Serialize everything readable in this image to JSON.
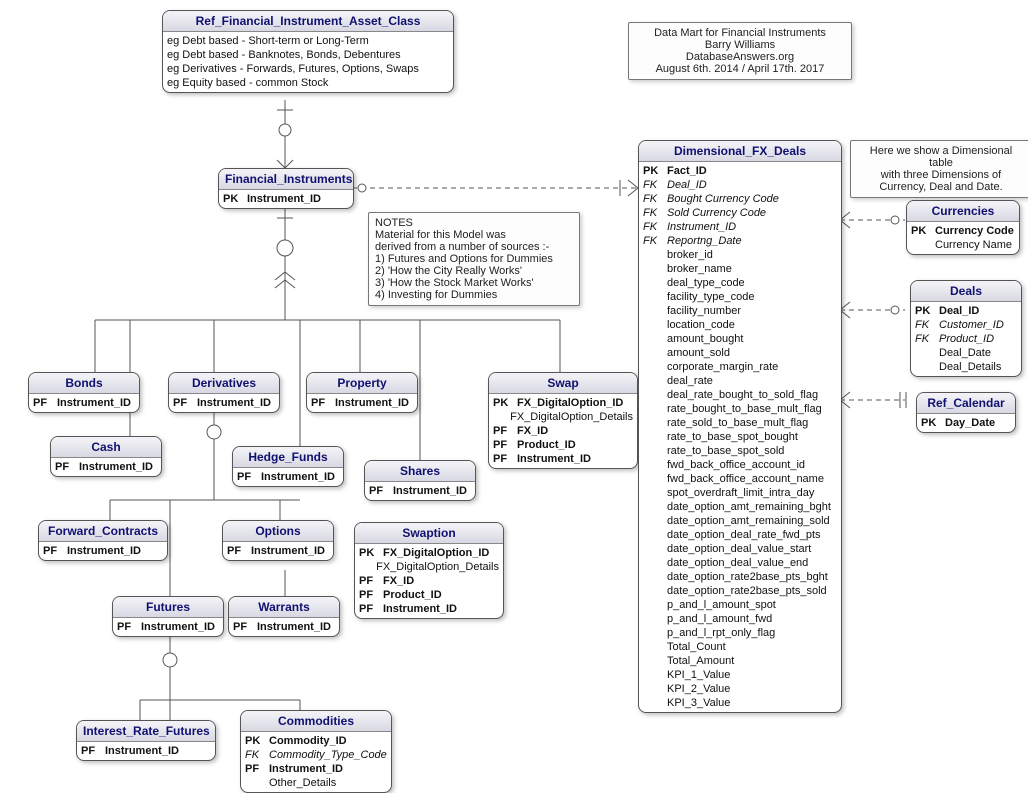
{
  "header_note": {
    "line1": "Data Mart for Financial Instruments",
    "line2": "Barry Williams",
    "line3": "DatabaseAnswers.org",
    "line4": "August 6th. 2014 / April 17th. 2017"
  },
  "dim_note": {
    "line1": "Here we show a Dimensional table",
    "line2": "with three Dimensions of",
    "line3": "Currency, Deal and Date."
  },
  "notes_box": {
    "title": "NOTES",
    "l1": "Material for this Model was",
    "l2": "derived from a number of sources :-",
    "l3": "1) Futures and Options for Dummies",
    "l4": "2) 'How the City Really Works'",
    "l5": "3) 'How the Stock Market Works'",
    "l6": "4) Investing for Dummies"
  },
  "ref_asset_class": {
    "title": "Ref_Financial_Instrument_Asset_Class",
    "l1": "eg Debt based - Short-term or Long-Term",
    "l2": "eg Debt based - Banknotes, Bonds, Debentures",
    "l3": "eg Derivatives - Forwards, Futures, Options, Swaps",
    "l4": "eg Equity based - common Stock"
  },
  "fin_instr": {
    "title": "Financial_Instruments",
    "pk": "Instrument_ID"
  },
  "bonds": {
    "title": "Bonds",
    "pf": "Instrument_ID"
  },
  "cash": {
    "title": "Cash",
    "pf": "Instrument_ID"
  },
  "derivatives": {
    "title": "Derivatives",
    "pf": "Instrument_ID"
  },
  "hedge": {
    "title": "Hedge_Funds",
    "pf": "Instrument_ID"
  },
  "property": {
    "title": "Property",
    "pf": "Instrument_ID"
  },
  "shares": {
    "title": "Shares",
    "pf": "Instrument_ID"
  },
  "forward": {
    "title": "Forward_Contracts",
    "pf": "Instrument_ID"
  },
  "options": {
    "title": "Options",
    "pf": "Instrument_ID"
  },
  "futures": {
    "title": "Futures",
    "pf": "Instrument_ID"
  },
  "warrants": {
    "title": "Warrants",
    "pf": "Instrument_ID"
  },
  "irf": {
    "title": "Interest_Rate_Futures",
    "pf": "Instrument_ID"
  },
  "swap": {
    "title": "Swap",
    "pk": "FX_DigitalOption_ID",
    "a1": "FX_DigitalOption_Details",
    "pf1": "FX_ID",
    "pf2": "Product_ID",
    "pf3": "Instrument_ID"
  },
  "swaption": {
    "title": "Swaption",
    "pk": "FX_DigitalOption_ID",
    "a1": "FX_DigitalOption_Details",
    "pf1": "FX_ID",
    "pf2": "Product_ID",
    "pf3": "Instrument_ID"
  },
  "commodities": {
    "title": "Commodities",
    "pk": "Commodity_ID",
    "fk": "Commodity_Type_Code",
    "pf": "Instrument_ID",
    "a1": "Other_Details"
  },
  "fx": {
    "title": "Dimensional_FX_Deals",
    "rows": [
      {
        "k": "PK",
        "n": "Fact_ID",
        "bold": true
      },
      {
        "k": "FK",
        "n": "Deal_ID",
        "it": true
      },
      {
        "k": "FK",
        "n": "Bought Currency Code",
        "it": true
      },
      {
        "k": "FK",
        "n": "Sold Currency Code",
        "it": true
      },
      {
        "k": "FK",
        "n": "Instrument_ID",
        "it": true
      },
      {
        "k": "FK",
        "n": "Reportng_Date",
        "it": true
      },
      {
        "k": "",
        "n": "broker_id"
      },
      {
        "k": "",
        "n": "broker_name"
      },
      {
        "k": "",
        "n": "deal_type_code"
      },
      {
        "k": "",
        "n": "facility_type_code"
      },
      {
        "k": "",
        "n": "facility_number"
      },
      {
        "k": "",
        "n": "location_code"
      },
      {
        "k": "",
        "n": "amount_bought"
      },
      {
        "k": "",
        "n": "amount_sold"
      },
      {
        "k": "",
        "n": "corporate_margin_rate"
      },
      {
        "k": "",
        "n": "deal_rate"
      },
      {
        "k": "",
        "n": "deal_rate_bought_to_sold_flag"
      },
      {
        "k": "",
        "n": "rate_bought_to_base_mult_flag"
      },
      {
        "k": "",
        "n": "rate_sold_to_base_mult_flag"
      },
      {
        "k": "",
        "n": "rate_to_base_spot_bought"
      },
      {
        "k": "",
        "n": "rate_to_base_spot_sold"
      },
      {
        "k": "",
        "n": "fwd_back_office_account_id"
      },
      {
        "k": "",
        "n": "fwd_back_office_account_name"
      },
      {
        "k": "",
        "n": "spot_overdraft_limit_intra_day"
      },
      {
        "k": "",
        "n": "date_option_amt_remaining_bght"
      },
      {
        "k": "",
        "n": "date_option_amt_remaining_sold"
      },
      {
        "k": "",
        "n": "date_option_deal_rate_fwd_pts"
      },
      {
        "k": "",
        "n": "date_option_deal_value_start"
      },
      {
        "k": "",
        "n": "date_option_deal_value_end"
      },
      {
        "k": "",
        "n": "date_option_rate2base_pts_bght"
      },
      {
        "k": "",
        "n": "date_option_rate2base_pts_sold"
      },
      {
        "k": "",
        "n": "p_and_l_amount_spot"
      },
      {
        "k": "",
        "n": "p_and_l_amount_fwd"
      },
      {
        "k": "",
        "n": "p_and_l_rpt_only_flag"
      },
      {
        "k": "",
        "n": "Total_Count"
      },
      {
        "k": "",
        "n": "Total_Amount"
      },
      {
        "k": "",
        "n": "KPI_1_Value"
      },
      {
        "k": "",
        "n": "KPI_2_Value"
      },
      {
        "k": "",
        "n": "KPI_3_Value"
      }
    ]
  },
  "currencies": {
    "title": "Currencies",
    "pk": "Currency Code",
    "a1": "Currency Name"
  },
  "deals": {
    "title": "Deals",
    "pk": "Deal_ID",
    "fk1": "Customer_ID",
    "fk2": "Product_ID",
    "a1": "Deal_Date",
    "a2": "Deal_Details"
  },
  "calendar": {
    "title": "Ref_Calendar",
    "pk": "Day_Date"
  },
  "key_labels": {
    "pk": "PK",
    "fk": "FK",
    "pf": "PF"
  }
}
